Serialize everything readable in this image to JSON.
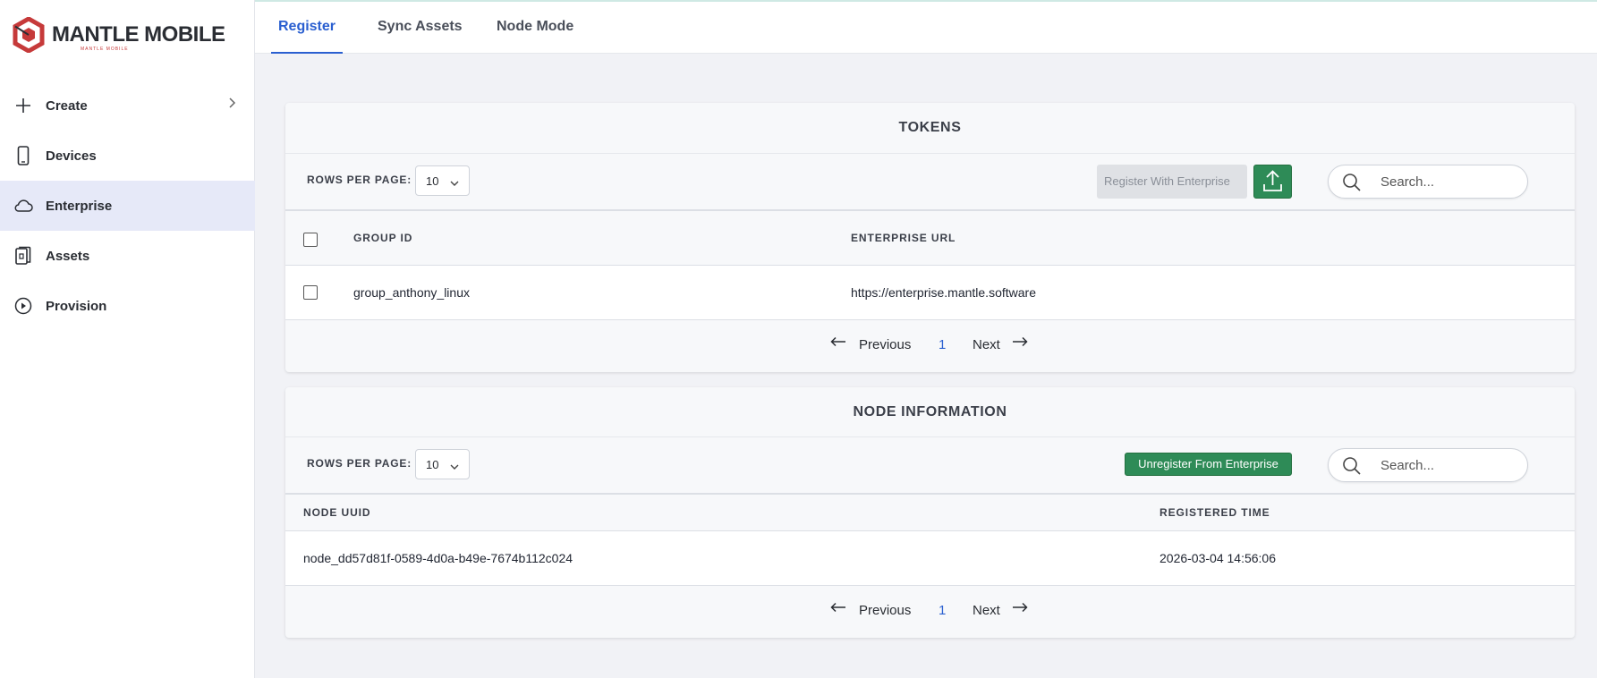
{
  "brand": {
    "name_part1": "MANTLE",
    "name_part2": "MOBILE",
    "tagline": "MANTLE MOBILE"
  },
  "sidebar": {
    "items": [
      {
        "label": "Create",
        "icon": "plus-icon",
        "has_chevron": true
      },
      {
        "label": "Devices",
        "icon": "phone-icon"
      },
      {
        "label": "Enterprise",
        "icon": "cloud-icon",
        "active": true
      },
      {
        "label": "Assets",
        "icon": "documents-icon"
      },
      {
        "label": "Provision",
        "icon": "play-circle-icon"
      }
    ]
  },
  "tabs": [
    {
      "label": "Register",
      "active": true
    },
    {
      "label": "Sync Assets"
    },
    {
      "label": "Node Mode"
    }
  ],
  "tokens": {
    "title": "TOKENS",
    "rows_per_page_label": "ROWS PER PAGE:",
    "rows_per_page_value": "10",
    "register_button": "Register With Enterprise",
    "search_placeholder": "Search...",
    "columns": [
      "GROUP ID",
      "ENTERPRISE URL"
    ],
    "rows": [
      {
        "group_id": "group_anthony_linux",
        "enterprise_url": "https://enterprise.mantle.software"
      }
    ],
    "pagination": {
      "previous": "Previous",
      "page": "1",
      "next": "Next"
    }
  },
  "node_info": {
    "title": "NODE INFORMATION",
    "rows_per_page_label": "ROWS PER PAGE:",
    "rows_per_page_value": "10",
    "unregister_button": "Unregister From Enterprise",
    "search_placeholder": "Search...",
    "columns": [
      "NODE UUID",
      "REGISTERED TIME"
    ],
    "rows": [
      {
        "node_uuid": "node_dd57d81f-0589-4d0a-b49e-7674b112c024",
        "registered_time": "2026-03-04 14:56:06"
      }
    ],
    "pagination": {
      "previous": "Previous",
      "page": "1",
      "next": "Next"
    }
  },
  "colors": {
    "accent": "#2a5fd0",
    "green": "#2e8b57",
    "brand_red": "#c63a3a",
    "active_nav_bg": "#e6e9f8"
  }
}
